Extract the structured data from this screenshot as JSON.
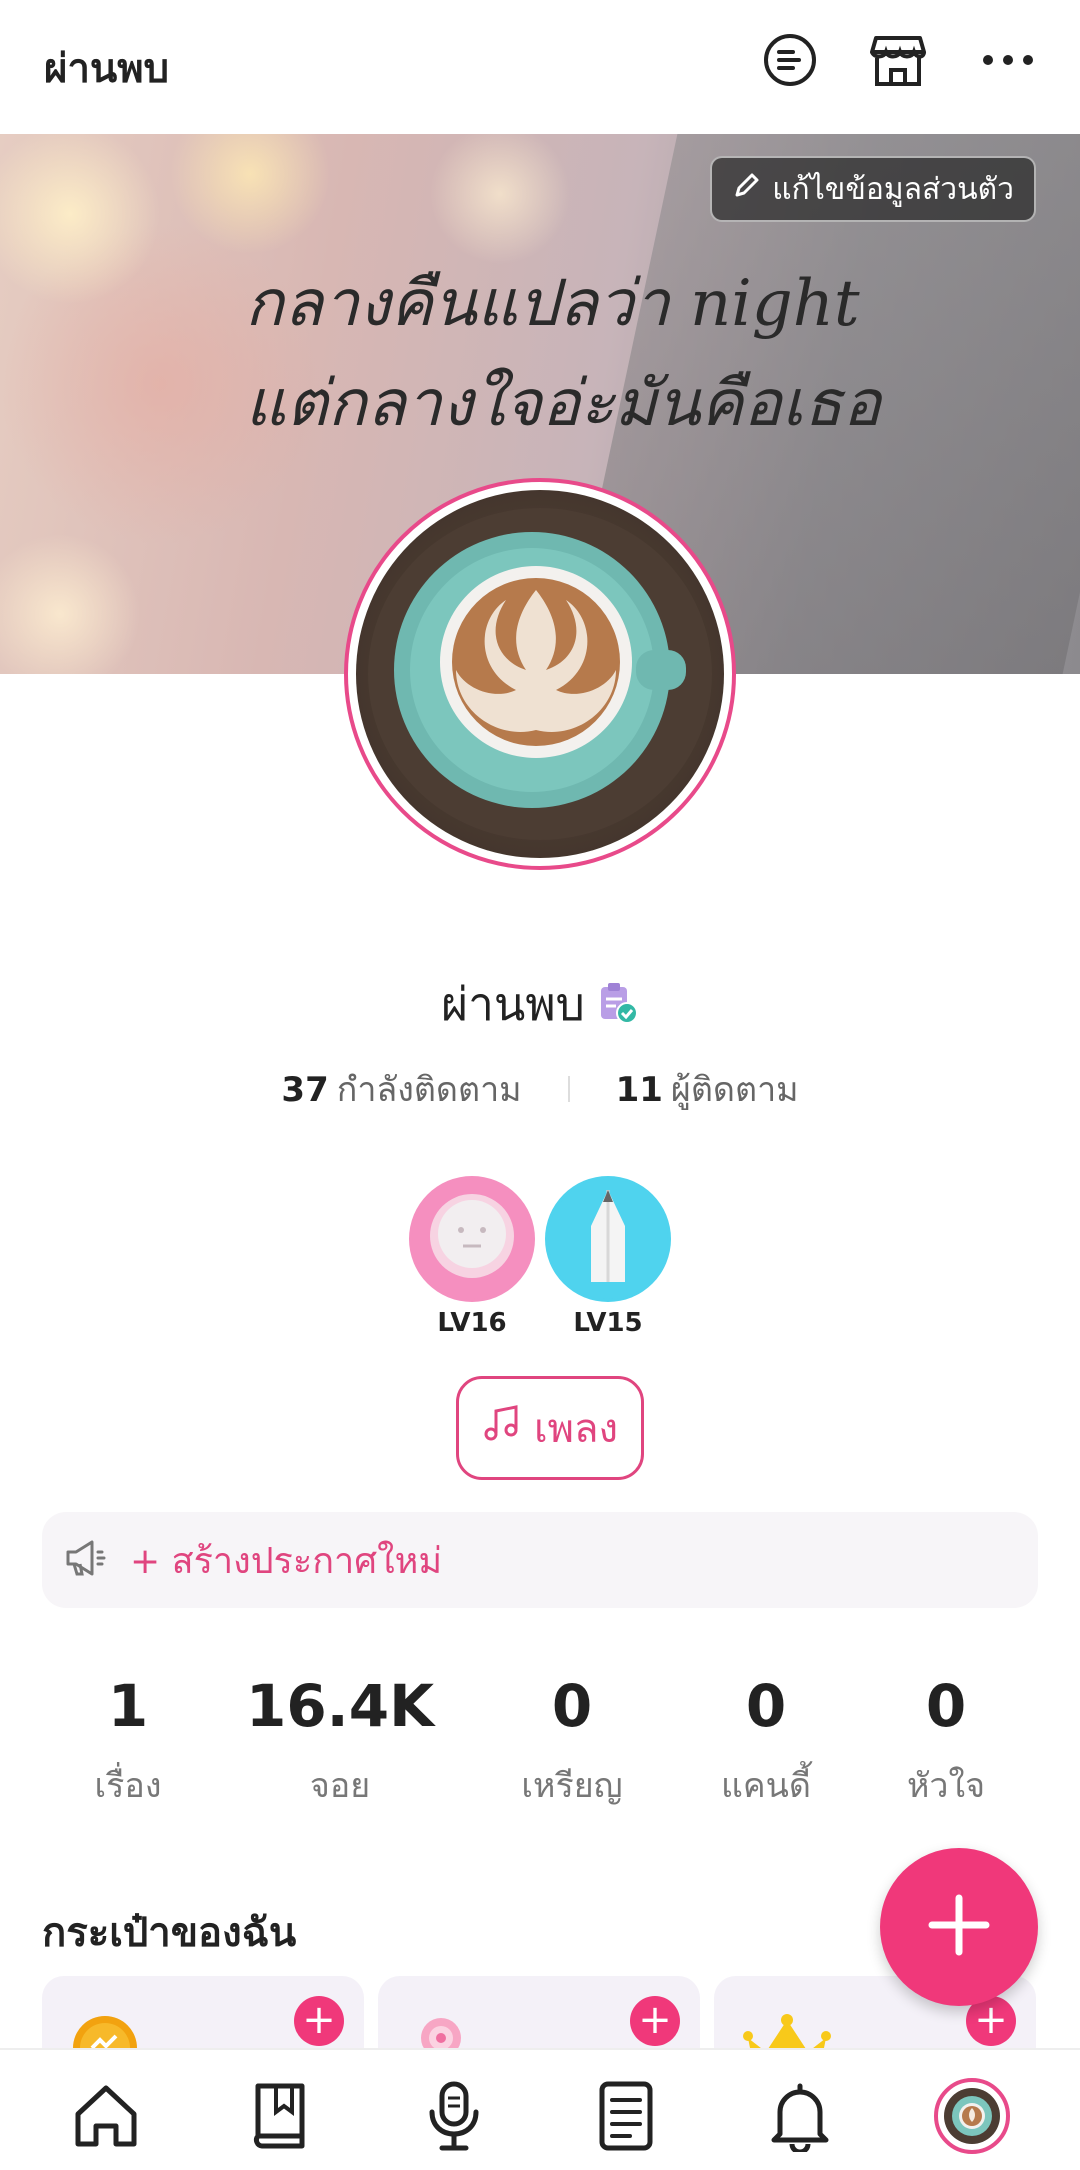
{
  "topbar": {
    "title": "ผ่านพบ",
    "icons": [
      "chat-list-icon",
      "store-icon",
      "more-icon"
    ]
  },
  "cover": {
    "quote_line1": "กลางคืนแปลว่า night",
    "quote_line2": "แต่กลางใจอ่ะมันคือเธอ",
    "edit_label": "แก้ไขข้อมูลส่วนตัว"
  },
  "profile": {
    "name": "ผ่านพบ",
    "following_count": "37",
    "following_label": "กำลังติดตาม",
    "followers_count": "11",
    "followers_label": "ผู้ติดตาม"
  },
  "badges": [
    {
      "level": "LV16",
      "color": "#f58fbf"
    },
    {
      "level": "LV15",
      "color": "#4fd3ee"
    }
  ],
  "song_label": "เพลง",
  "announce_label": "+ สร้างประกาศใหม่",
  "stats": [
    {
      "value": "1",
      "label": "เรื่อง"
    },
    {
      "value": "16.4K",
      "label": "จอย"
    },
    {
      "value": "0",
      "label": "เหรียญ"
    },
    {
      "value": "0",
      "label": "แคนดี้"
    },
    {
      "value": "0",
      "label": "หัวใจ"
    }
  ],
  "wallet": {
    "title": "กระเป๋าของฉัน",
    "cards": [
      {
        "icon": "coin-icon"
      },
      {
        "icon": "candy-icon"
      },
      {
        "icon": "crown-icon"
      }
    ]
  },
  "bottom_nav": [
    "home-icon",
    "book-icon",
    "microphone-icon",
    "document-icon",
    "bell-icon",
    "profile-avatar"
  ],
  "colors": {
    "accent": "#f0387a",
    "accent_text": "#e0457f"
  }
}
